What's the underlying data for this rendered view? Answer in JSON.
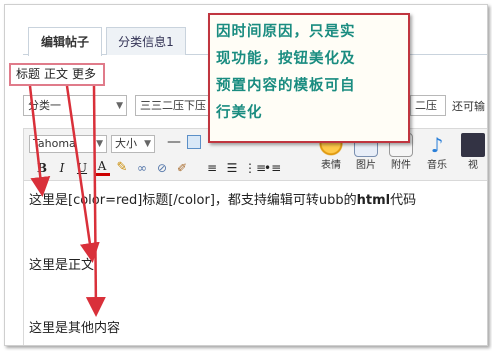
{
  "tabs": [
    {
      "label": "编辑帖子",
      "active": true
    },
    {
      "label": "分类信息1",
      "active": false
    }
  ],
  "section_labels": [
    "标题",
    "正文",
    "更多"
  ],
  "category_select": {
    "value": "分类一"
  },
  "title_input": {
    "value": "三三二压下压"
  },
  "right_input": {
    "value": "二压"
  },
  "right_text": "还可输",
  "toolbar": {
    "font_family": "Tahoma",
    "font_size": "大小",
    "buttons": {
      "bold": "B",
      "italic": "I",
      "underline": "U",
      "color": "A",
      "emoji_label": "表情",
      "image_label": "图片",
      "attach_label": "附件",
      "music_label": "音乐",
      "video_label": "视"
    }
  },
  "editor": {
    "line1_prefix": "这里是[color=red]标题[/color]，都支持编辑可转ubb的",
    "line1_bold": "html",
    "line1_suffix": "代码",
    "line2": "这里是正文",
    "line3": "这里是其他内容"
  },
  "callout": {
    "lines": [
      "因时间原因，只是实",
      "现功能，按钮美化及",
      "预置内容的模板可自",
      "行美化"
    ]
  },
  "colors": {
    "callout_border": "#c0353f",
    "callout_text": "#1a8c80",
    "label_box_border": "#e07b8a",
    "arrow": "#d9303a"
  }
}
